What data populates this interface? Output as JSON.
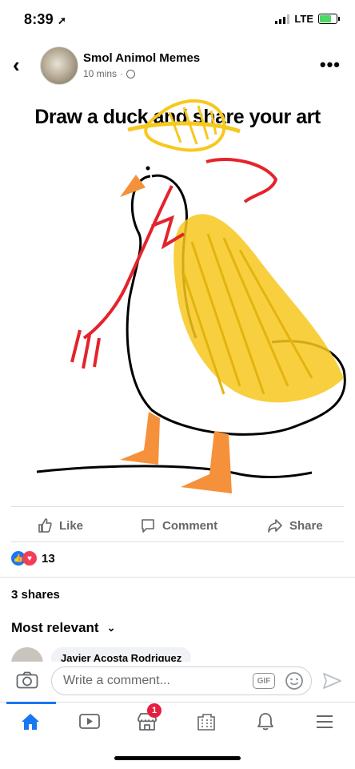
{
  "status_bar": {
    "time": "8:39",
    "network": "LTE"
  },
  "post_header": {
    "page_name": "Smol Animol Memes",
    "time": "10 mins",
    "time_separator": "·"
  },
  "post_image": {
    "caption": "Draw a duck and share your art"
  },
  "actions": {
    "like": "Like",
    "comment": "Comment",
    "share": "Share"
  },
  "reactions": {
    "count": "13"
  },
  "shares": {
    "text": "3 shares"
  },
  "comments": {
    "sort_label": "Most relevant",
    "preview_author": "Javier Acosta Rodriguez"
  },
  "composer": {
    "placeholder": "Write a comment...",
    "gif_label": "GIF"
  },
  "tabbar": {
    "marketplace_badge": "1"
  },
  "colors": {
    "accent": "#1877f2",
    "badge": "#e41e3f",
    "drawing_yellow": "#f7c81d",
    "drawing_red": "#e5232c",
    "duck_orange": "#f5913a"
  }
}
